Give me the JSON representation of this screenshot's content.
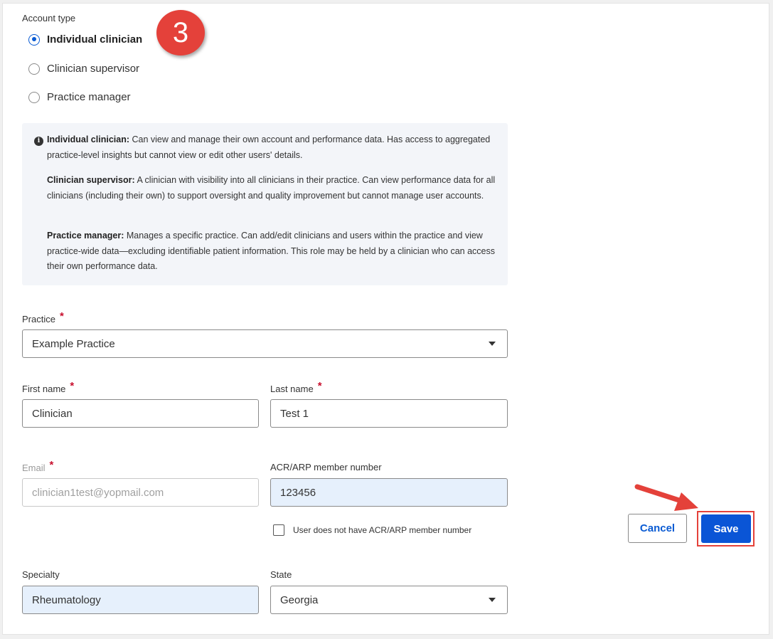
{
  "account_type": {
    "label": "Account type",
    "options": [
      {
        "label": "Individual clinician",
        "checked": true
      },
      {
        "label": "Clinician supervisor",
        "checked": false
      },
      {
        "label": "Practice manager",
        "checked": false
      }
    ]
  },
  "step_badge": "3",
  "info": {
    "icon": "info-icon",
    "individual_title": "Individual clinician:",
    "individual_text": " Can view and manage their own account and performance data. Has access to aggregated practice-level insights but cannot view or edit other users' details.",
    "supervisor_title": "Clinician supervisor:",
    "supervisor_text": " A clinician with visibility into all clinicians in their practice. Can view performance data for all clinicians (including their own) to support oversight and quality improvement but cannot manage user accounts.",
    "manager_title": "Practice manager:",
    "manager_text": " Manages a specific practice. Can add/edit clinicians and users within the practice and view practice-wide data—excluding identifiable patient information. This role may be held by a clinician who can access their own performance data."
  },
  "form": {
    "required_marker": "*",
    "practice": {
      "label": "Practice",
      "value": "Example Practice"
    },
    "first_name": {
      "label": "First name",
      "value": "Clinician"
    },
    "last_name": {
      "label": "Last name",
      "value": "Test 1"
    },
    "email": {
      "label": "Email",
      "value": "clinician1test@yopmail.com"
    },
    "member_number": {
      "label": "ACR/ARP member number",
      "value": "123456"
    },
    "no_member_checkbox": {
      "label": "User does not have ACR/ARP member number",
      "checked": false
    },
    "specialty": {
      "label": "Specialty",
      "value": "Rheumatology"
    },
    "state": {
      "label": "State",
      "value": "Georgia"
    }
  },
  "actions": {
    "cancel_label": "Cancel",
    "save_label": "Save"
  },
  "colors": {
    "accent": "#0a55d6",
    "annotation_red": "#e4413a",
    "required": "#c8102e",
    "filled_field": "#e6f0fc",
    "info_bg": "#f3f5f9"
  }
}
